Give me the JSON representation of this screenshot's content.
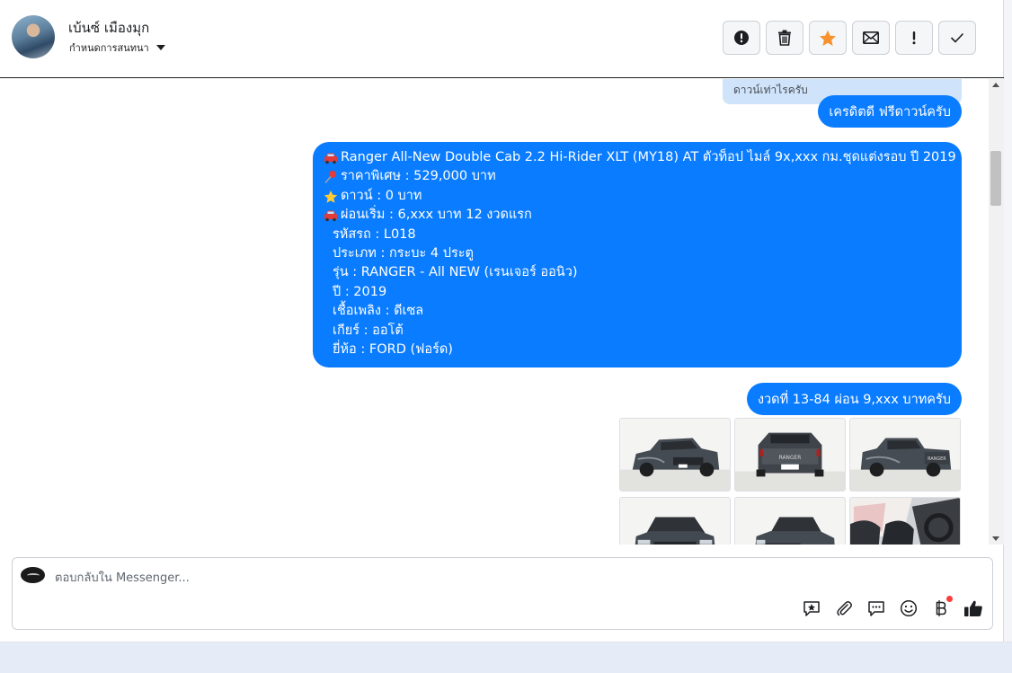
{
  "header": {
    "contact_name": "เบ้นซ์ เมืองมุก",
    "assign_label": "กำหนดการสนทนา",
    "toolbar": [
      {
        "name": "report-button",
        "icon": "exclamation-circle-icon"
      },
      {
        "name": "delete-button",
        "icon": "trash-icon"
      },
      {
        "name": "star-button",
        "icon": "star-icon",
        "color": "#f7922f"
      },
      {
        "name": "mark-unread-button",
        "icon": "envelope-icon"
      },
      {
        "name": "follow-up-button",
        "icon": "exclamation-icon"
      },
      {
        "name": "done-button",
        "icon": "check-icon"
      }
    ]
  },
  "messages": {
    "previous_fragment": "ดาวน์เท่าไรครับ",
    "credit": "เครดิตดี ฟรีดาวน์ครับ",
    "car_details": {
      "line1": "Ranger All-New Double Cab 2.2 Hi-Rider XLT (MY18) AT ตัวท็อป ไมล์ 9x,xxx กม.ชุดแต่งรอบ ปี 2019",
      "line2": "ราคาพิเศษ : 529,000 บาท",
      "line3": "ดาวน์ : 0 บาท",
      "line4": "ผ่อนเริ่ม : 6,xxx บาท 12 งวดแรก",
      "line5": "รหัสรถ : L018",
      "line6": "ประเภท : กระบะ 4 ประตู",
      "line7": "รุ่น : RANGER - All NEW (เรนเจอร์ ออนิว)",
      "line8": "ปี : 2019",
      "line9": "เชื้อเพลิง : ดีเซล",
      "line10": "เกียร์ : ออโต้",
      "line11": "ยี่ห้อ : FORD (ฟอร์ด)"
    },
    "installment": "งวดที่ 13-84 ผ่อน 9,xxx บาทครับ",
    "photos": [
      {
        "view": "front-left"
      },
      {
        "view": "rear"
      },
      {
        "view": "rear-left"
      },
      {
        "view": "front"
      },
      {
        "view": "front-right"
      },
      {
        "view": "interior"
      }
    ]
  },
  "composer": {
    "placeholder": "ตอบกลับใน Messenger...",
    "tools": [
      "saved-reply-icon",
      "attachment-icon",
      "chat-bubble-icon",
      "emoji-icon",
      "baht-payment-icon",
      "thumbs-up-icon"
    ]
  },
  "colors": {
    "bubble": "#0a7cff",
    "previous_bubble": "#cfe3fa",
    "star": "#f7922f",
    "notification_dot": "#fa3e3e"
  }
}
